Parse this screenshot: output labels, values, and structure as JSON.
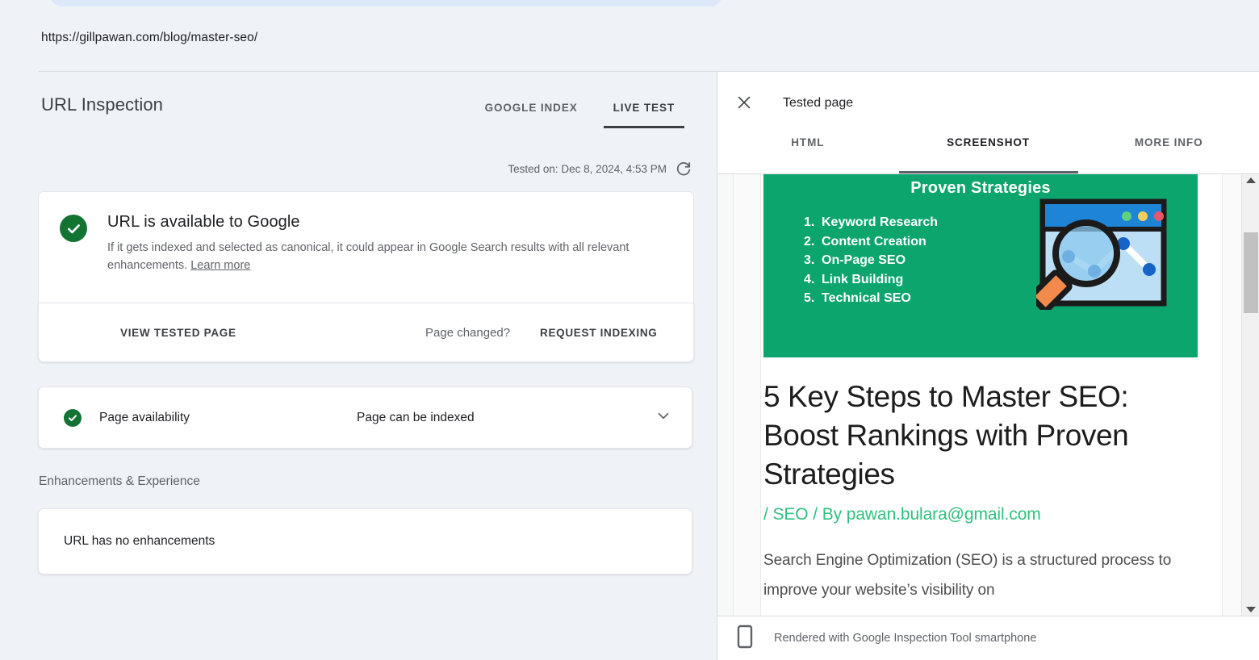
{
  "left": {
    "url": "https://gillpawan.com/blog/master-seo/",
    "page_title": "URL Inspection",
    "tabs": [
      {
        "label": "GOOGLE INDEX",
        "active": false
      },
      {
        "label": "LIVE TEST",
        "active": true
      }
    ],
    "tested_on": "Tested on: Dec 8, 2024, 4:53 PM",
    "refresh_icon": "refresh-icon",
    "status_card": {
      "icon": "check-circle-icon",
      "icon_color": "#137333",
      "title": "URL is available to Google",
      "description": "If it gets indexed and selected as canonical, it could appear in Google Search results with all relevant enhancements.",
      "learn_more": "Learn more"
    },
    "actions": {
      "view_tested_page": "VIEW TESTED PAGE",
      "page_changed": "Page changed?",
      "request_indexing": "REQUEST INDEXING"
    },
    "availability": {
      "icon": "check-circle-icon",
      "label": "Page availability",
      "value": "Page can be indexed",
      "chevron": "chevron-down-icon"
    },
    "enhancements_heading": "Enhancements & Experience",
    "enhancements_text": "URL has no enhancements"
  },
  "panel": {
    "close_icon": "close-icon",
    "title": "Tested page",
    "tabs": [
      {
        "label": "HTML",
        "active": false
      },
      {
        "label": "SCREENSHOT",
        "active": true
      },
      {
        "label": "MORE INFO",
        "active": false
      }
    ],
    "footer": {
      "icon": "smartphone-icon",
      "text": "Rendered with Google Inspection Tool smartphone"
    },
    "scrollbar": {
      "up_arrow": "scroll-up-arrow-icon",
      "down_arrow": "scroll-down-arrow-icon",
      "thumb": "scrollbar-thumb"
    }
  },
  "preview": {
    "hero": {
      "background_color": "#0ca56e",
      "title": "Proven Strategies",
      "items": [
        {
          "num": "1.",
          "label": "Keyword Research"
        },
        {
          "num": "2.",
          "label": "Content Creation"
        },
        {
          "num": "3.",
          "label": "On-Page SEO"
        },
        {
          "num": "4.",
          "label": "Link Building"
        },
        {
          "num": "5.",
          "label": "Technical SEO"
        }
      ],
      "artwork": "browser-window-magnifier-chart-illustration"
    },
    "article": {
      "title": "5 Key Steps to Master SEO: Boost Rankings with Proven Strategies",
      "meta": "/ SEO / By pawan.bulara@gmail.com",
      "meta_color": "#2ec27e",
      "body": "Search Engine Optimization (SEO) is a structured process to improve your website’s visibility on"
    }
  }
}
